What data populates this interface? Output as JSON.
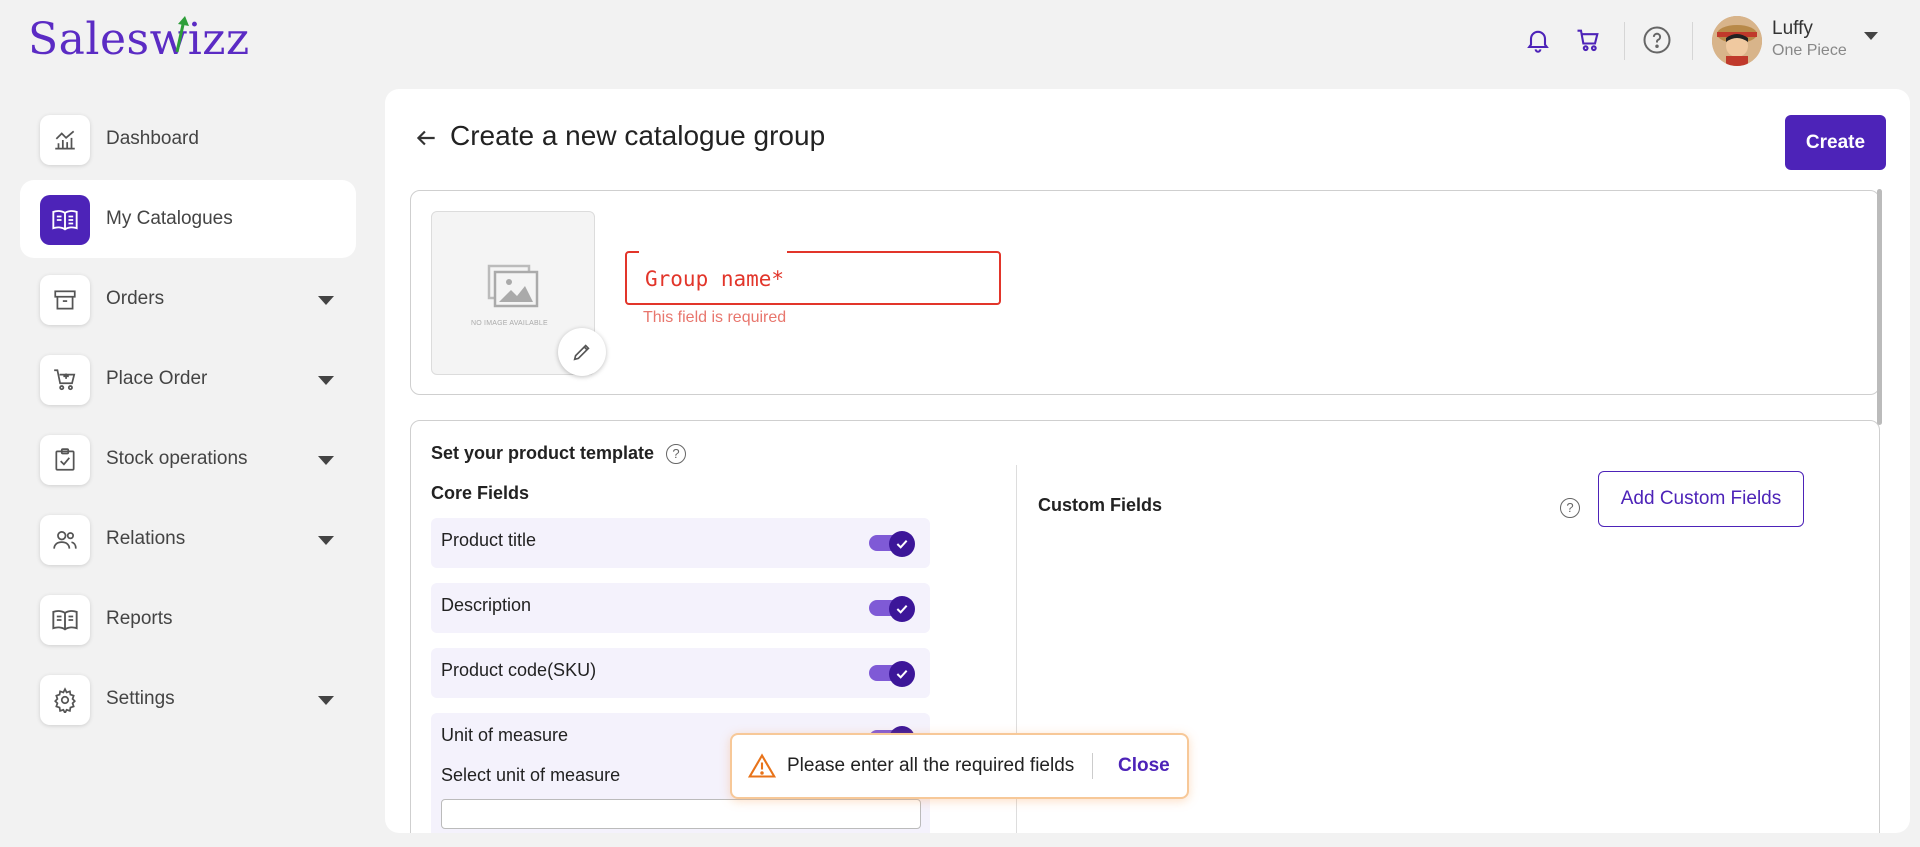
{
  "app": {
    "logo_text": "Saleswizz",
    "brand_color": "#4d23b8",
    "error_color": "#e2352a"
  },
  "user": {
    "name": "Luffy",
    "subtitle": "One Piece"
  },
  "topbar_icons": [
    "bell-icon",
    "cart-icon",
    "help-icon"
  ],
  "sidebar": {
    "items": [
      {
        "label": "Dashboard",
        "icon": "chart-icon",
        "active": false,
        "has_caret": false
      },
      {
        "label": "My Catalogues",
        "icon": "book-icon",
        "active": true,
        "has_caret": false
      },
      {
        "label": "Orders",
        "icon": "archive-icon",
        "active": false,
        "has_caret": true
      },
      {
        "label": "Place Order",
        "icon": "cart-add-icon",
        "active": false,
        "has_caret": true
      },
      {
        "label": "Stock operations",
        "icon": "clipboard-check-icon",
        "active": false,
        "has_caret": true
      },
      {
        "label": "Relations",
        "icon": "people-icon",
        "active": false,
        "has_caret": true
      },
      {
        "label": "Reports",
        "icon": "report-book-icon",
        "active": false,
        "has_caret": false
      },
      {
        "label": "Settings",
        "icon": "gear-icon",
        "active": false,
        "has_caret": true
      }
    ]
  },
  "page": {
    "title": "Create a new catalogue group",
    "create_label": "Create",
    "no_image_text": "NO IMAGE AVAILABLE",
    "group_name_placeholder": "Group name*",
    "group_name_value": "",
    "group_name_error": "This field is required"
  },
  "template": {
    "title": "Set your product template",
    "core_title": "Core Fields",
    "core_fields": [
      {
        "label": "Product title",
        "enabled": true
      },
      {
        "label": "Description",
        "enabled": true
      },
      {
        "label": "Product code(SKU)",
        "enabled": true
      },
      {
        "label": "Unit of measure",
        "enabled": true
      }
    ],
    "unit_select_label": "Select unit of measure",
    "custom_title": "Custom Fields",
    "add_custom_label": "Add Custom Fields"
  },
  "toast": {
    "message": "Please enter all the required fields",
    "close_label": "Close"
  }
}
